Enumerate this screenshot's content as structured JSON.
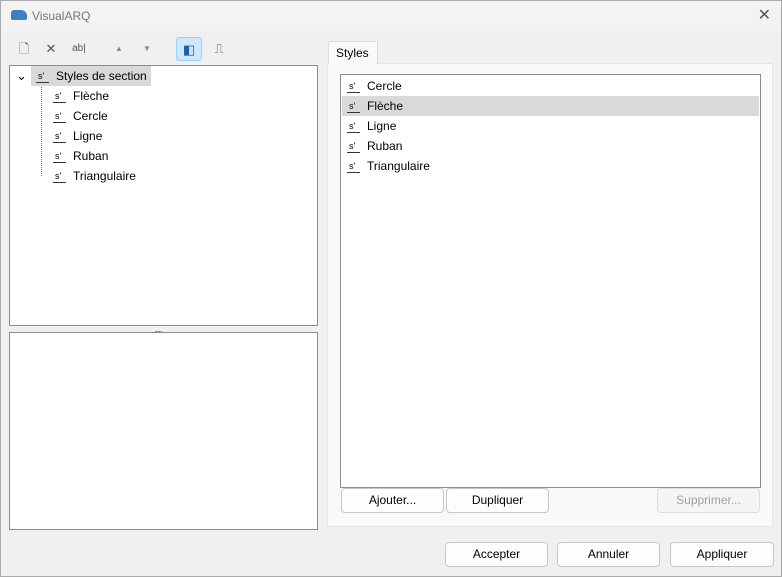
{
  "window": {
    "title": "VisualARQ",
    "close": "✕"
  },
  "toolbar": [
    {
      "icon": "new-doc-icon",
      "glyph": "🗋"
    },
    {
      "icon": "delete-icon",
      "glyph": "✕"
    },
    {
      "icon": "rename-icon",
      "glyph": "ab|"
    },
    {
      "icon": "move-up-icon",
      "glyph": "▲"
    },
    {
      "icon": "move-down-icon",
      "glyph": "▼"
    },
    {
      "icon": "preview-layout-icon",
      "glyph": "◧"
    },
    {
      "icon": "profile-icon",
      "glyph": "⎍"
    }
  ],
  "tree": {
    "root": "Styles de section",
    "expand": "⌄",
    "children": [
      "Flèche",
      "Cercle",
      "Ligne",
      "Ruban",
      "Triangulaire"
    ]
  },
  "splitter": ".....",
  "tab": "Styles",
  "list": {
    "items": [
      "Cercle",
      "Flèche",
      "Ligne",
      "Ruban",
      "Triangulaire"
    ],
    "selected": "Flèche"
  },
  "buttons": {
    "add": "Ajouter...",
    "duplicate": "Dupliquer",
    "delete": "Supprimer...",
    "accept": "Accepter",
    "cancel": "Annuler",
    "apply": "Appliquer"
  }
}
